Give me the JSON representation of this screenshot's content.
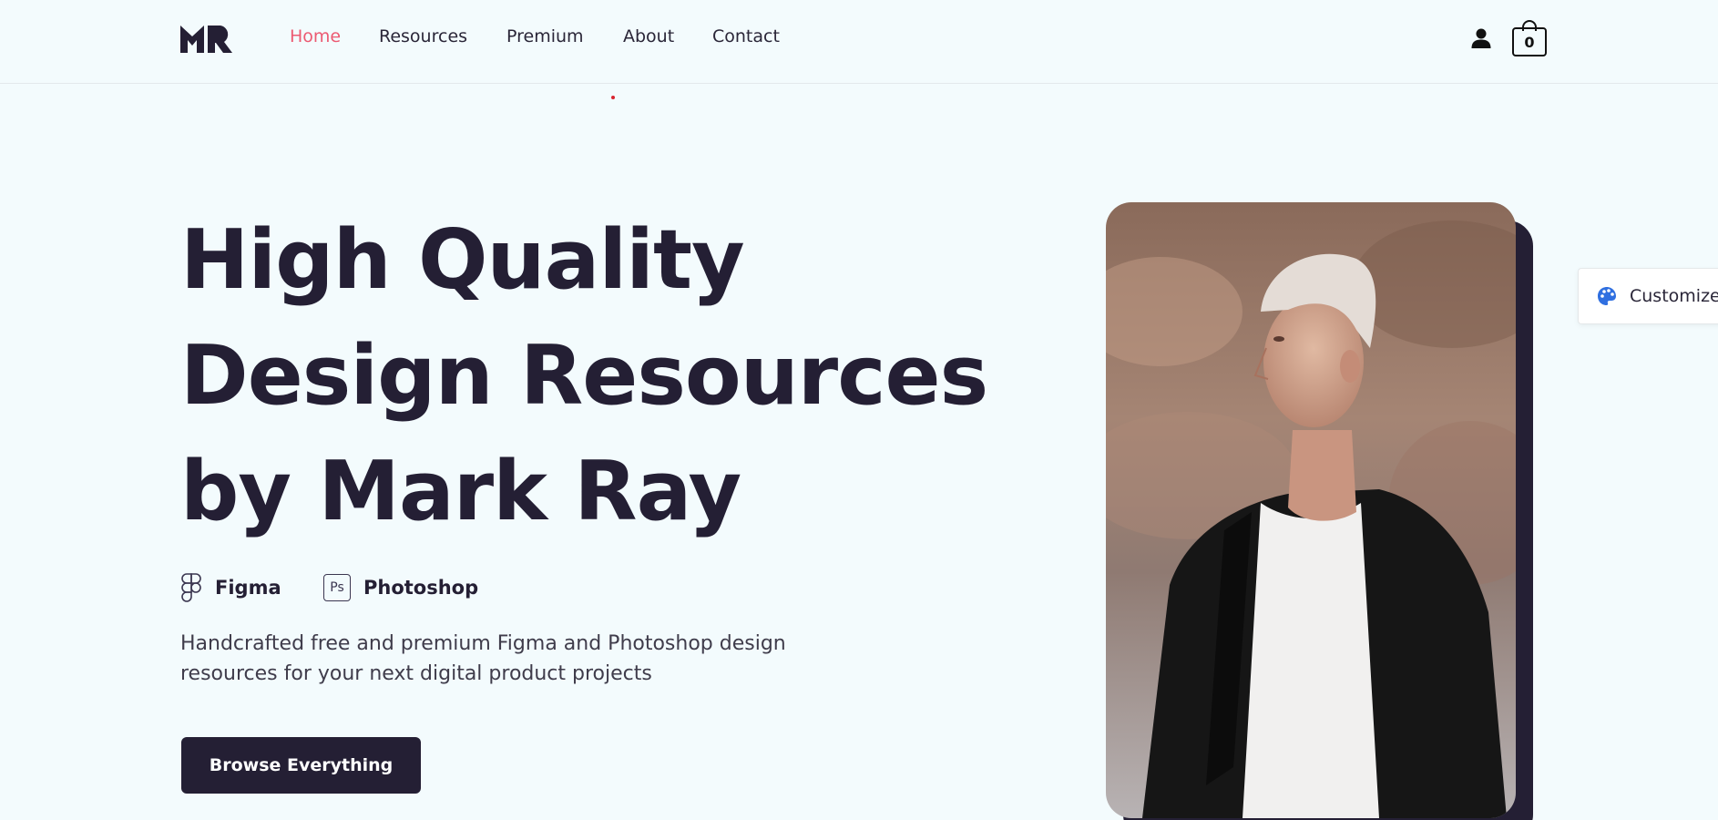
{
  "header": {
    "logo_text": "MR",
    "nav": [
      {
        "label": "Home",
        "active": true
      },
      {
        "label": "Resources",
        "active": false
      },
      {
        "label": "Premium",
        "active": false
      },
      {
        "label": "About",
        "active": false
      },
      {
        "label": "Contact",
        "active": false
      }
    ],
    "user_icon": "user-icon",
    "cart_icon": "shopping-bag-icon",
    "cart_count": "0"
  },
  "hero": {
    "title_lines": [
      "High Quality",
      "Design Resources",
      "by Mark Ray"
    ],
    "tools": [
      {
        "icon": "figma-icon",
        "label": "Figma"
      },
      {
        "icon": "photoshop-icon",
        "icon_text": "Ps",
        "label": "Photoshop"
      }
    ],
    "description": "Handcrafted free and premium Figma and Photoshop design resources for your next digital product projects",
    "cta_label": "Browse Everything"
  },
  "customize": {
    "icon": "palette-icon",
    "label": "Customize"
  },
  "colors": {
    "background": "#f3fbfd",
    "primary_dark": "#241f34",
    "nav_active": "#ec5a72",
    "palette_icon": "#2f6fe0"
  }
}
